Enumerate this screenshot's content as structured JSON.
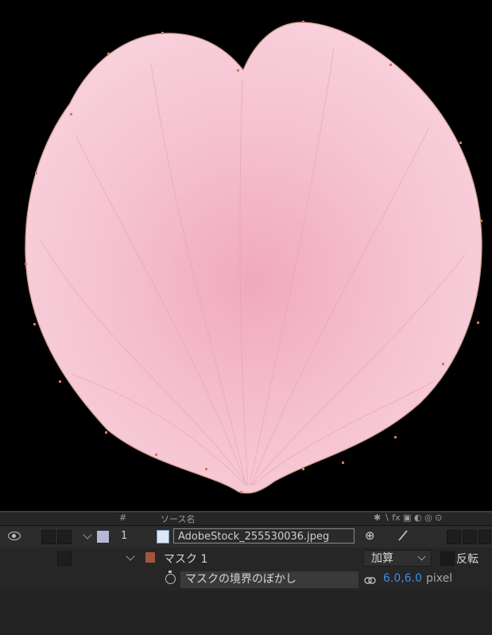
{
  "timeline": {
    "header": {
      "hash_label": "#",
      "source_name_label": "ソース名"
    },
    "layer": {
      "number": "1",
      "name": "AdobeStock_255530036.jpeg",
      "switch_glyph": "⊕"
    },
    "mask": {
      "name": "マスク 1",
      "mode": "加算",
      "invert_label": "反転"
    },
    "feather": {
      "property_name": "マスクの境界のぼかし",
      "value": "6.0,6.0",
      "unit": "pixel"
    }
  },
  "colors": {
    "petal": "#f2bccb",
    "layer_label": "#b7b7d8",
    "mask_label": "#a0563a",
    "value_blue": "#3d8ee6"
  }
}
